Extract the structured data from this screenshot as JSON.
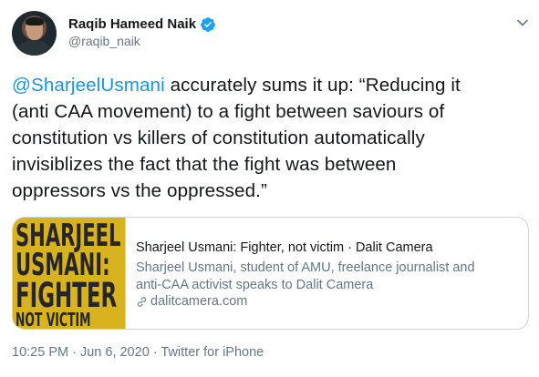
{
  "author": {
    "name": "Raqib Hameed Naik",
    "handle": "@raqib_naik",
    "avatar_icon": "profile-photo",
    "verified_icon": "verified-badge-icon"
  },
  "colors": {
    "link": "#1b95e0",
    "secondary_text": "#657786",
    "card_image_bg": "#d8b31f",
    "verified": "#1da1f2"
  },
  "tweet": {
    "mention": "@SharjeelUsmani",
    "lines": [
      " accurately sums it up: “Reducing it",
      "(anti CAA movement) to a fight between saviours of",
      "constitution vs killers of constitution automatically",
      "invisiblizes the fact that the fight was between",
      "oppressors vs the oppressed.”"
    ]
  },
  "card": {
    "image_text": [
      "SHARJEEL",
      "USMANI:",
      "FIGHTER",
      "NOT VICTIM"
    ],
    "title": "Sharjeel Usmani: Fighter, not victim · Dalit Camera",
    "description_lines": [
      "Sharjeel Usmani, student of AMU, freelance journalist and",
      "anti-CAA activist speaks to Dalit Camera"
    ],
    "domain": "dalitcamera.com",
    "link_icon": "link-icon"
  },
  "meta": {
    "time": "10:25 PM",
    "separator": " · ",
    "date": "Jun 6, 2020",
    "source": "Twitter for iPhone"
  }
}
